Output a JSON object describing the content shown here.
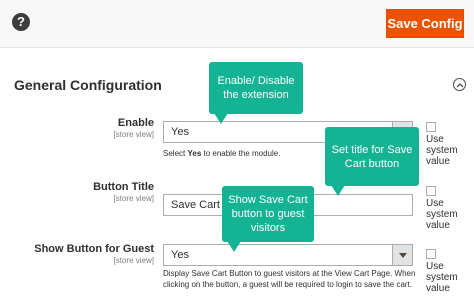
{
  "header": {
    "save_label": "Save Config",
    "help_glyph": "?"
  },
  "section": {
    "title": "General Configuration"
  },
  "fields": [
    {
      "label": "Enable",
      "scope": "[store view]",
      "value": "Yes",
      "note_prefix": "Select ",
      "note_bold": "Yes",
      "note_suffix": " to enable the module.",
      "system_value": "Use system value"
    },
    {
      "label": "Button Title",
      "scope": "[store view]",
      "value": "Save Cart",
      "system_value": "Use system value"
    },
    {
      "label": "Show Button for Guest",
      "scope": "[store view]",
      "value": "Yes",
      "note_line1": "Display Save Cart Button to guest visitors at the View Cart Page. When",
      "note_line2": "clicking on the button, a guest will be required to login to save the cart.",
      "system_value": "Use system value"
    }
  ],
  "callouts": {
    "enable": "Enable/ Disable the extension",
    "title": "Set title for Save Cart button",
    "guest": "Show Save Cart button to guest visitors"
  },
  "colors": {
    "accent": "#eb5202",
    "callout": "#14b394"
  }
}
